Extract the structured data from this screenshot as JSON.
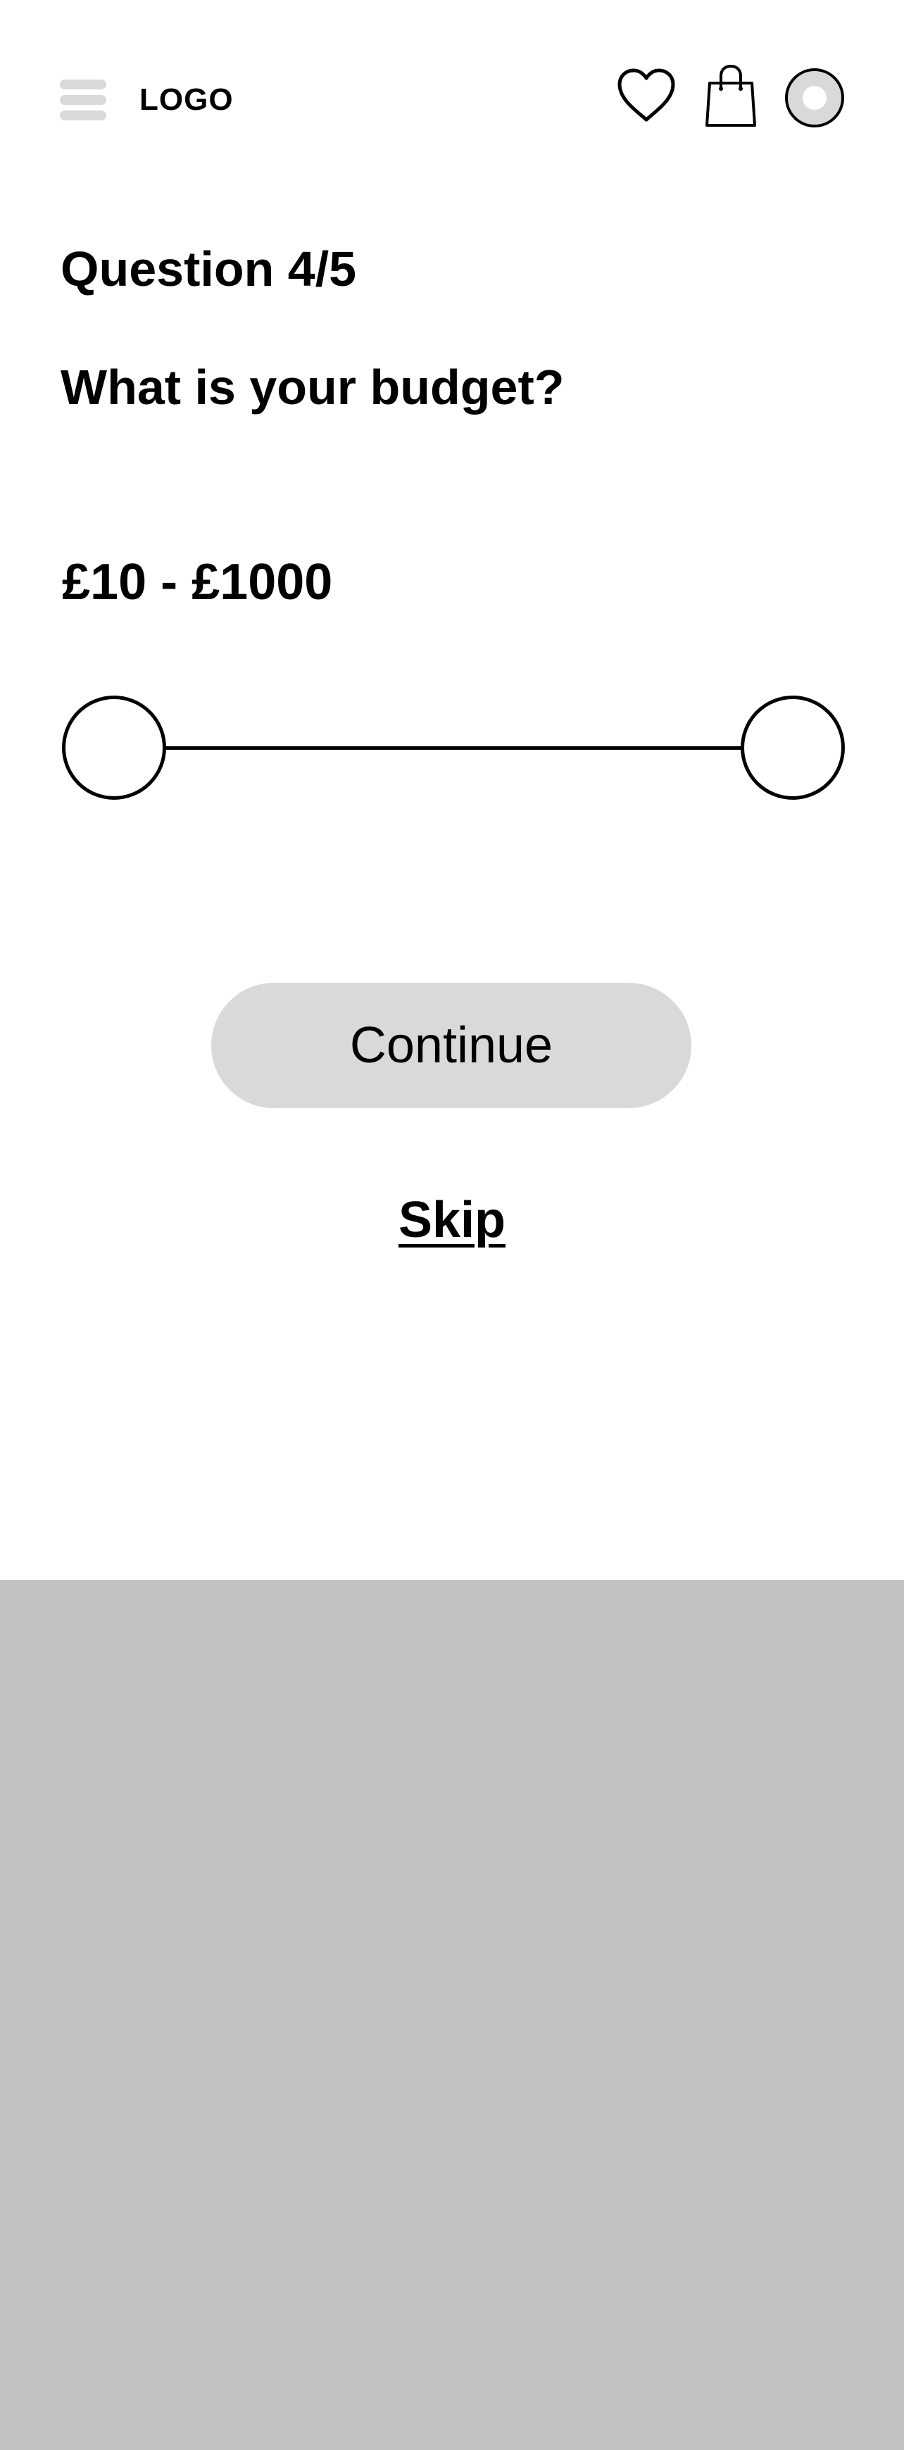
{
  "header": {
    "logo_text": "LOGO",
    "icons": {
      "menu": "hamburger-menu-icon",
      "favorites": "heart-icon",
      "cart": "shopping-bag-icon",
      "profile": "avatar"
    }
  },
  "quiz": {
    "step_label": "Question 4/5",
    "question": "What is your budget?",
    "range_label": "£10 - £1000"
  },
  "slider": {
    "min_value": 10,
    "max_value": 1000,
    "currency": "£"
  },
  "actions": {
    "continue_label": "Continue",
    "skip_label": "Skip"
  },
  "colors": {
    "button_background": "#d9d9d9",
    "menu_bars": "#d9d9d9",
    "bottom_panel": "#c2c2c2",
    "text": "#000000"
  }
}
